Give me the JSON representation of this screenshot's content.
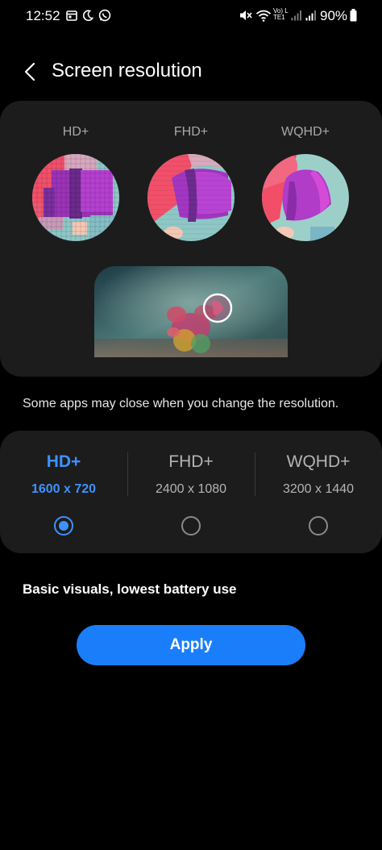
{
  "status_bar": {
    "time": "12:52",
    "battery": "90%",
    "icons": [
      "calendar-icon",
      "moon-icon",
      "whatsapp-icon",
      "mute-icon",
      "wifi-icon",
      "volte-icon",
      "signal-icon",
      "signal-icon",
      "battery-icon"
    ],
    "volte_text": "Vo) LTE1"
  },
  "header": {
    "title": "Screen resolution",
    "back_icon": "chevron-left-icon"
  },
  "preview": {
    "labels": [
      "HD+",
      "FHD+",
      "WQHD+"
    ]
  },
  "note": "Some apps may close when you change the resolution.",
  "options": [
    {
      "name": "HD+",
      "resolution": "1600 x 720",
      "selected": true
    },
    {
      "name": "FHD+",
      "resolution": "2400 x 1080",
      "selected": false
    },
    {
      "name": "WQHD+",
      "resolution": "3200 x 1440",
      "selected": false
    }
  ],
  "description": "Basic visuals, lowest battery use",
  "apply_label": "Apply",
  "colors": {
    "accent": "#3e91ff",
    "button": "#1a7efb",
    "card": "#1c1c1c",
    "background": "#000000"
  }
}
